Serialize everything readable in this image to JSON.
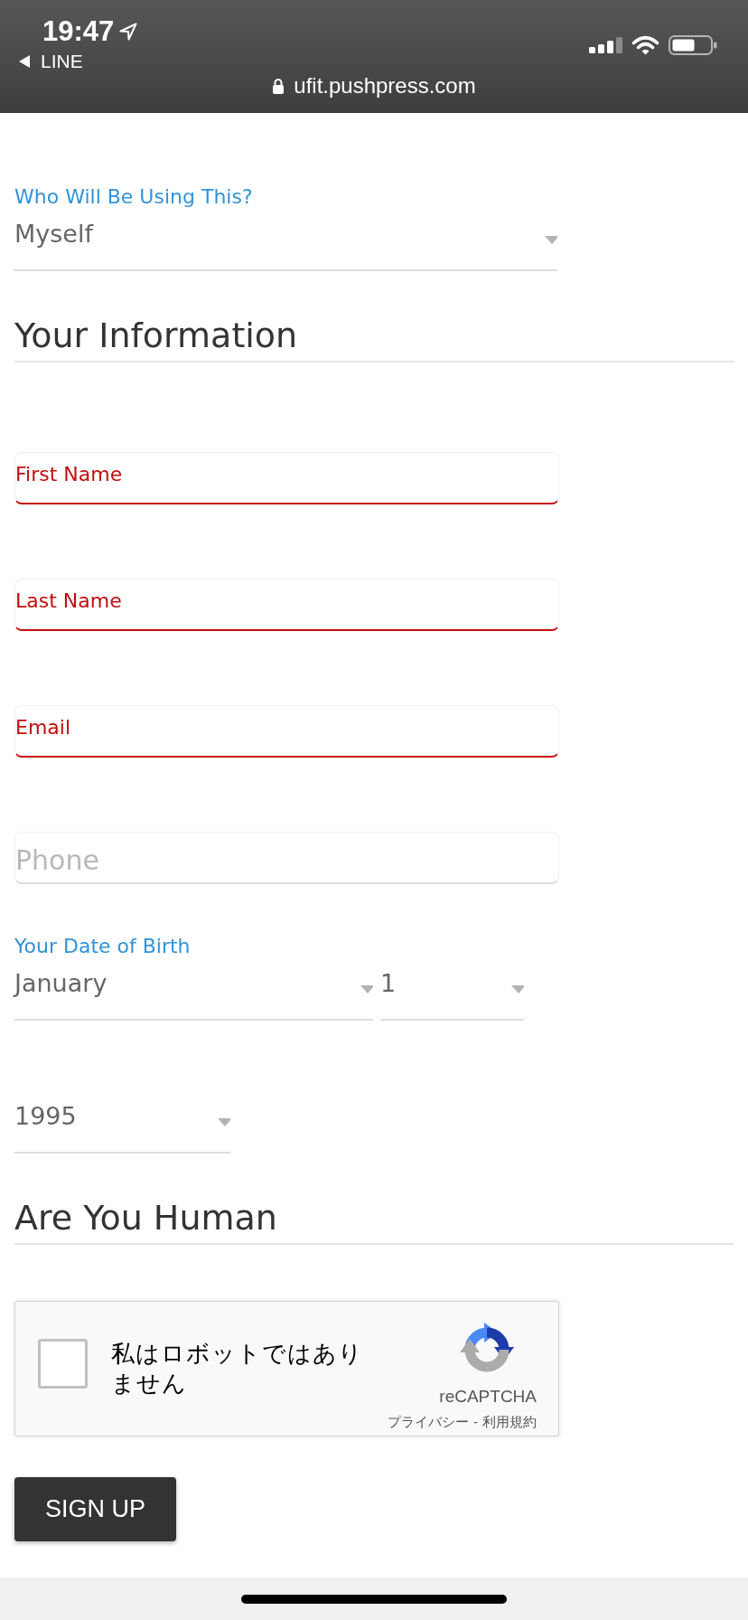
{
  "status_bar": {
    "time": "19:47",
    "back_label": "LINE",
    "url": "ufit.pushpress.com"
  },
  "user_select": {
    "label": "Who Will Be Using This?",
    "value": "Myself"
  },
  "information": {
    "heading": "Your Information",
    "fields": [
      {
        "placeholder": "First Name",
        "error": true
      },
      {
        "placeholder": "Last Name",
        "error": true
      },
      {
        "placeholder": "Email",
        "error": true
      },
      {
        "placeholder": "Phone",
        "error": false
      }
    ],
    "date_of_birth": {
      "label": "Your Date of Birth",
      "selects": [
        {
          "value": "January"
        },
        {
          "value": "1"
        },
        {
          "value": "1995"
        }
      ]
    }
  },
  "human_check": {
    "heading": "Are You Human",
    "captcha": {
      "checked": false,
      "label": "私はロボットではありません",
      "caption": "reCAPTCHA",
      "links": [
        "プライバシー",
        "利用規約"
      ],
      "link_separator": "-"
    }
  },
  "submit": {
    "label": "SIGN UP"
  }
}
